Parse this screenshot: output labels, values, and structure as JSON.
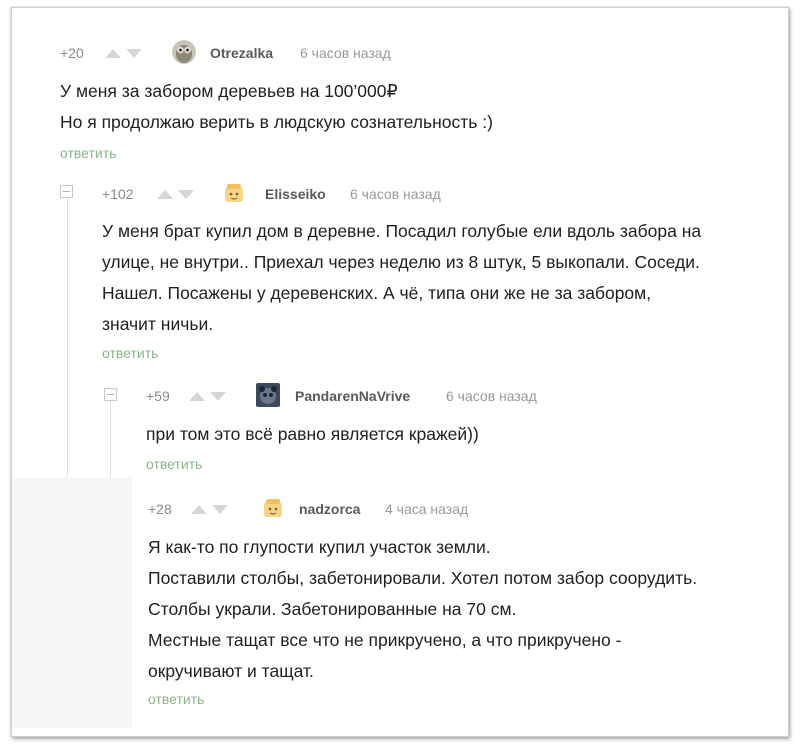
{
  "comments": [
    {
      "rating": "+20",
      "username": "Otrezalka",
      "time": "6 часов назад",
      "avatar": "owl-avatar",
      "lines": [
        "У меня за забором деревьев на 100’000₽",
        "Но я продолжаю верить в людскую сознательность :)"
      ],
      "reply": "ответить"
    },
    {
      "rating": "+102",
      "username": "Elisseiko",
      "time": "6 часов назад",
      "avatar": "default-avatar",
      "lines": [
        "У меня брат купил дом в деревне. Посадил голубые ели вдоль забора на",
        "улице, не внутри.. Приехал через неделю из 8 штук, 5 выкопали. Соседи.",
        "Нашел. Посажены у деревенских. А чё, типа они же не за забором,",
        "значит ничьи."
      ],
      "reply": "ответить"
    },
    {
      "rating": "+59",
      "username": "PandarenNaVrive",
      "time": "6 часов назад",
      "avatar": "panda-avatar",
      "lines": [
        "при том это всё равно является кражей))"
      ],
      "reply": "ответить"
    },
    {
      "rating": "+28",
      "username": "nadzorca",
      "time": "4 часа назад",
      "avatar": "default-avatar",
      "lines": [
        "Я как-то по глупости купил участок земли.",
        "Поставили столбы, забетонировали. Хотел потом забор соорудить.",
        "Столбы украли. Забетонированные на 70 см.",
        "Местные тащат все что не прикручено, а что прикручено -",
        "окручивают и тащат."
      ],
      "reply": "ответить"
    }
  ],
  "colors": {
    "username": "#5a5a5a",
    "reply_link": "#8ab48a",
    "meta": "#9a9a9a",
    "vote_arrow": "#d6d6d6"
  }
}
